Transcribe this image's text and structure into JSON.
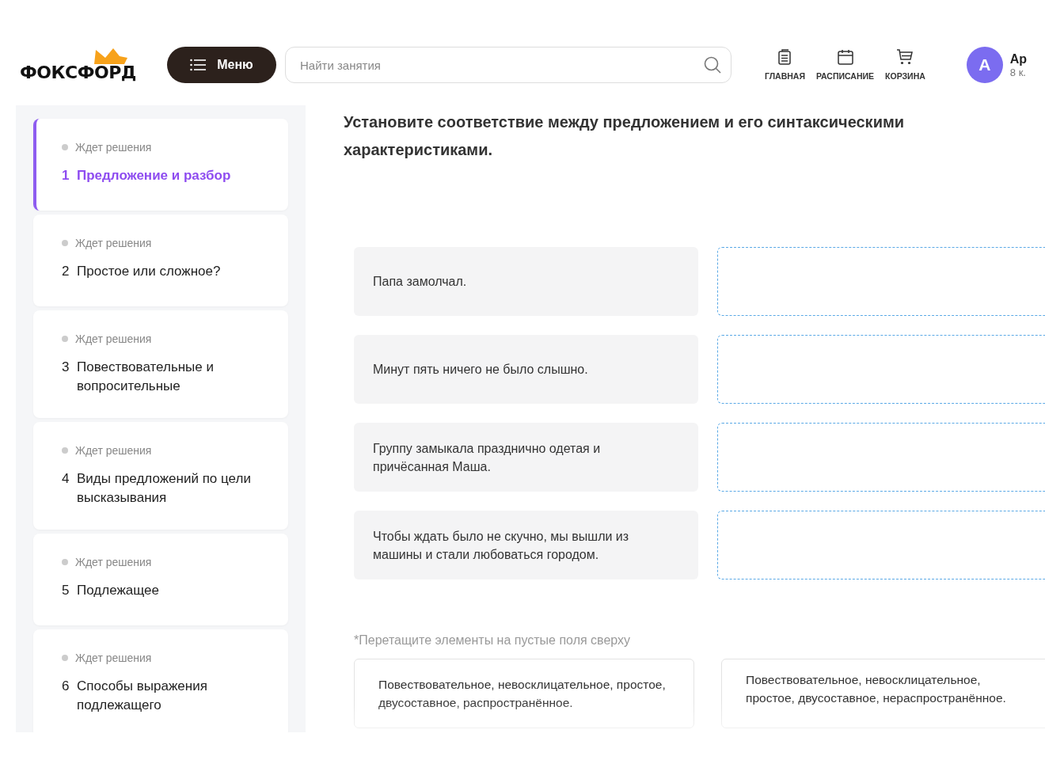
{
  "header": {
    "logo": "ФОКСФОРД",
    "menu_button": "Меню",
    "search": {
      "placeholder": "Найти занятия"
    },
    "nav": [
      {
        "label": "ГЛАВНАЯ",
        "kind": "notes"
      },
      {
        "label": "РАСПИСАНИЕ",
        "kind": "calendar"
      },
      {
        "label": "КОРЗИНА",
        "kind": "cart"
      }
    ],
    "profile": {
      "initial": "А",
      "name": "Ар",
      "grade": "8 к."
    }
  },
  "lessons": [
    {
      "status": "Ждет решения",
      "number": "1",
      "title": "Предложение и разбор",
      "selected": true
    },
    {
      "status": "Ждет решения",
      "number": "2",
      "title": "Простое или сложное?",
      "selected": false
    },
    {
      "status": "Ждет решения",
      "number": "3",
      "title": "Повествовательные и вопросительные",
      "selected": false
    },
    {
      "status": "Ждет решения",
      "number": "4",
      "title": "Виды предложений по цели высказывания",
      "selected": false
    },
    {
      "status": "Ждет решения",
      "number": "5",
      "title": "Подлежащее",
      "selected": false
    },
    {
      "status": "Ждет решения",
      "number": "6",
      "title": "Способы выражения подлежащего",
      "selected": false
    }
  ],
  "task": {
    "title": "Установите соответствие между предложением и его синтаксическими характеристиками.",
    "sentences": [
      "Папа замолчал.",
      "Минут пять ничего не было слышно.",
      "Группу замыкала празднично одетая и причёсанная Маша.",
      "Чтобы ждать было не скучно, мы вышли из машины и стали любоваться городом."
    ],
    "hint": "*Перетащите элементы на пустые поля сверху",
    "options": [
      "Повествовательное, невосклицательное, простое, двусоставное, распространённое.",
      "Повествовательное, невосклицательное, простое, двусоставное, нераспространённое."
    ]
  }
}
